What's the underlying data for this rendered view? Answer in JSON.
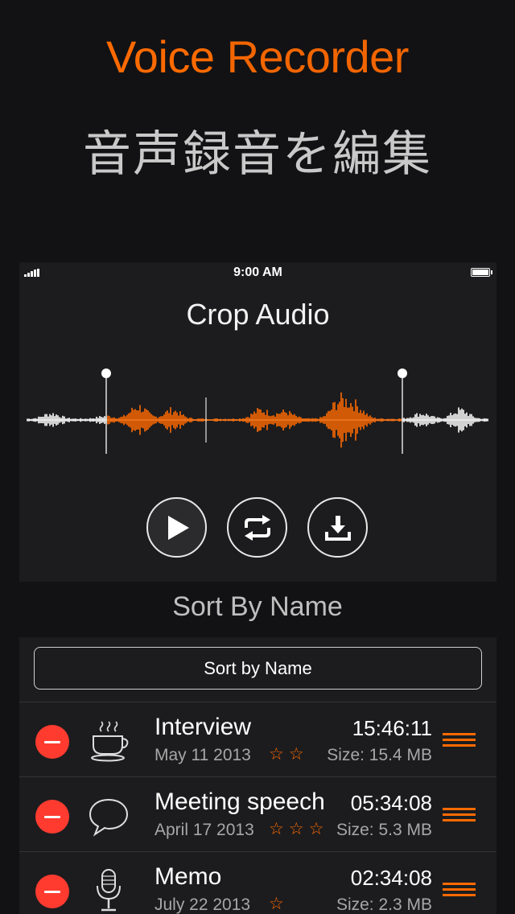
{
  "promo": {
    "title_word1": "Voice",
    "title_word2": "Recorder",
    "subtitle": "音声録音を編集"
  },
  "phone": {
    "status_time": "9:00 AM",
    "screen_title": "Crop Audio",
    "controls": [
      {
        "name": "play-button",
        "icon": "play-icon"
      },
      {
        "name": "loop-button",
        "icon": "repeat-icon"
      },
      {
        "name": "save-button",
        "icon": "download-icon"
      }
    ]
  },
  "section_label": "Sort By Name",
  "list": {
    "sort_button_label": "Sort by Name",
    "recordings": [
      {
        "name": "Interview",
        "date": "May 11 2013",
        "stars": "☆☆",
        "duration": "15:46:11",
        "size": "Size: 15.4 MB",
        "icon": "coffee-cup-icon"
      },
      {
        "name": "Meeting speech",
        "date": "April 17 2013",
        "stars": "☆☆☆",
        "duration": "05:34:08",
        "size": "Size: 5.3 MB",
        "icon": "speech-bubble-icon"
      },
      {
        "name": "Memo",
        "date": "July 22 2013",
        "stars": "☆",
        "duration": "02:34:08",
        "size": "Size: 2.3 MB",
        "icon": "microphone-icon"
      }
    ]
  },
  "colors": {
    "accent": "#ff6a00",
    "delete": "#ff3b30",
    "background": "#121214",
    "panel": "#1c1c1e"
  }
}
